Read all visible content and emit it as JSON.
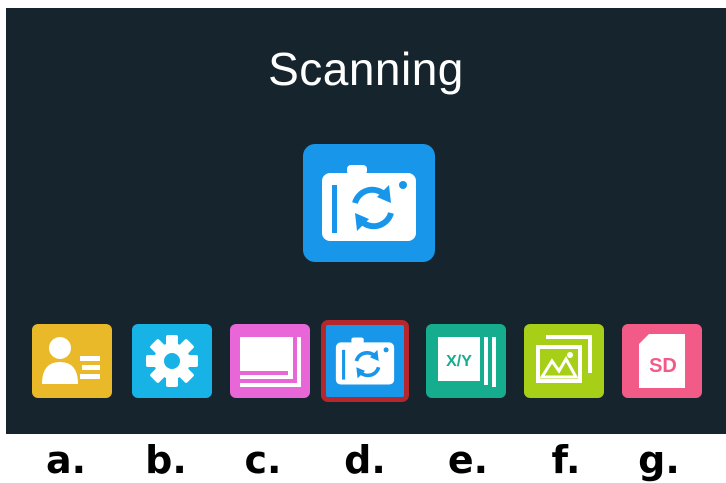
{
  "screen": {
    "title": "Scanning",
    "main_icon": "scan-camera-icon",
    "colors": {
      "background": "#16252d",
      "selection": "#b3272d"
    }
  },
  "menu": {
    "items": [
      {
        "id": "a",
        "icon": "contact-card-icon",
        "color": "#e9b92a"
      },
      {
        "id": "b",
        "icon": "gear-icon",
        "color": "#17b3e6"
      },
      {
        "id": "c",
        "icon": "gallery-stack-icon",
        "color": "#e866d8"
      },
      {
        "id": "d",
        "icon": "scan-camera-icon",
        "color": "#1896ea",
        "selected": true
      },
      {
        "id": "e",
        "icon": "xy-documents-icon",
        "color": "#16ad8e",
        "text": "X/Y"
      },
      {
        "id": "f",
        "icon": "photo-stack-icon",
        "color": "#a8cf18"
      },
      {
        "id": "g",
        "icon": "sd-card-icon",
        "color": "#f25b88",
        "text": "SD"
      }
    ]
  },
  "labels": [
    "a.",
    "b.",
    "c.",
    "d.",
    "e.",
    "f.",
    "g."
  ]
}
